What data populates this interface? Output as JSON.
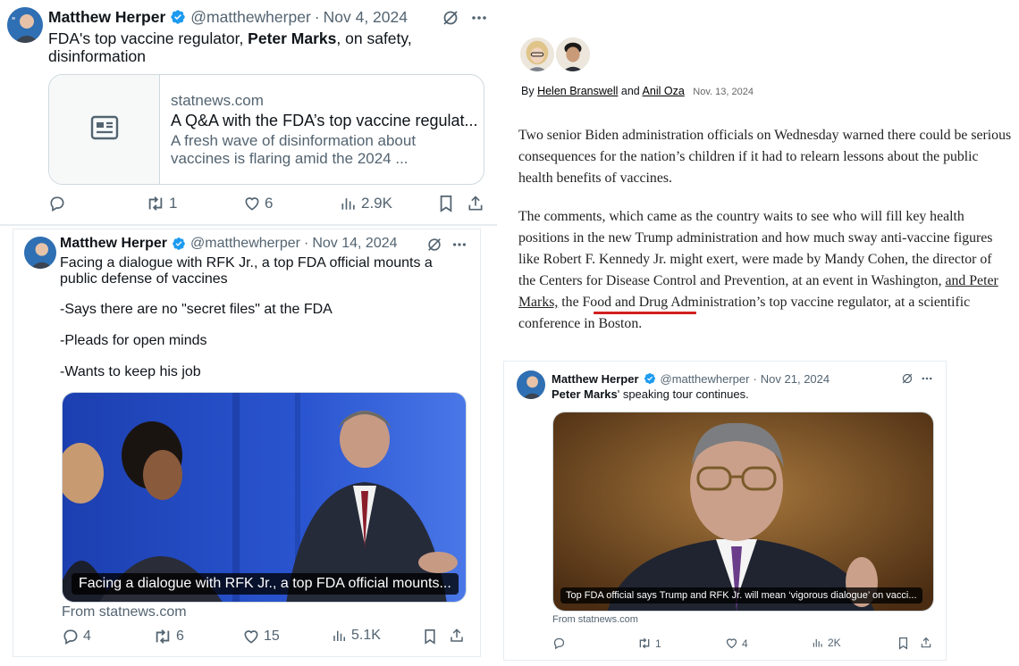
{
  "tweet1": {
    "name": "Matthew Herper",
    "handle": "@matthewherper",
    "sep": "·",
    "date": "Nov 4, 2024",
    "text_before": "FDA's top vaccine regulator, ",
    "text_bold": "Peter Marks",
    "text_after": ", on safety, disinformation",
    "card": {
      "domain": "statnews.com",
      "title": "A Q&A with the FDA’s top vaccine regulat...",
      "description": "A fresh wave of disinformation about vaccines is flaring amid the 2024 ..."
    },
    "replies": "",
    "reposts": "1",
    "likes": "6",
    "views": "2.9K"
  },
  "tweet2": {
    "name": "Matthew Herper",
    "handle": "@matthewherper",
    "sep": "·",
    "date": "Nov 14, 2024",
    "line1": "Facing a dialogue with RFK Jr., a top FDA official mounts a public defense of vaccines",
    "line2": "-Says there are no \"secret files\" at the FDA",
    "line3": "-Pleads for open minds",
    "line4": "-Wants to keep his job",
    "caption": "Facing a dialogue with RFK Jr., a top FDA official mounts...",
    "from": "From statnews.com",
    "replies": "4",
    "reposts": "6",
    "likes": "15",
    "views": "5.1K"
  },
  "article": {
    "by": "By",
    "author1": "Helen Branswell",
    "and": "and",
    "author2": "Anil Oza",
    "date": "Nov. 13, 2024",
    "para1": "Two senior Biden administration officials on Wednesday warned there could be serious consequences for the nation’s children if it had to relearn lessons about the public health benefits of vaccines.",
    "para2_before": "The comments, which came as the country waits to see who will fill key health positions in the new Trump administration and how much sway anti-vaccine figures like Robert F. Kennedy Jr. might exert, were made by Mandy Cohen, the director of the Centers for Disease Control and Prevention, at an event in Washington, ",
    "para2_highlight": "and Peter Marks,",
    "para2_after": " the Food and Drug Administration’s top vaccine regulator, at a scientific conference in Boston."
  },
  "tweet3": {
    "name": "Matthew Herper",
    "handle": "@matthewherper",
    "sep": "·",
    "date": "Nov 21, 2024",
    "text_bold": "Peter Marks",
    "text_after": "' speaking tour continues.",
    "caption": "Top FDA official says Trump and RFK Jr. will mean ‘vigorous dialogue’ on vacci...",
    "from": "From statnews.com",
    "replies": "",
    "reposts": "1",
    "likes": "4",
    "views": "2K"
  },
  "colors": {
    "verified": "#1d9bf0",
    "muted": "#536471",
    "highlight_underline": "#d21f1f"
  },
  "icons": [
    "grok-icon",
    "more-icon",
    "reply-icon",
    "repost-icon",
    "like-icon",
    "views-icon",
    "bookmark-icon",
    "share-icon",
    "verified-badge-icon",
    "article-icon"
  ]
}
